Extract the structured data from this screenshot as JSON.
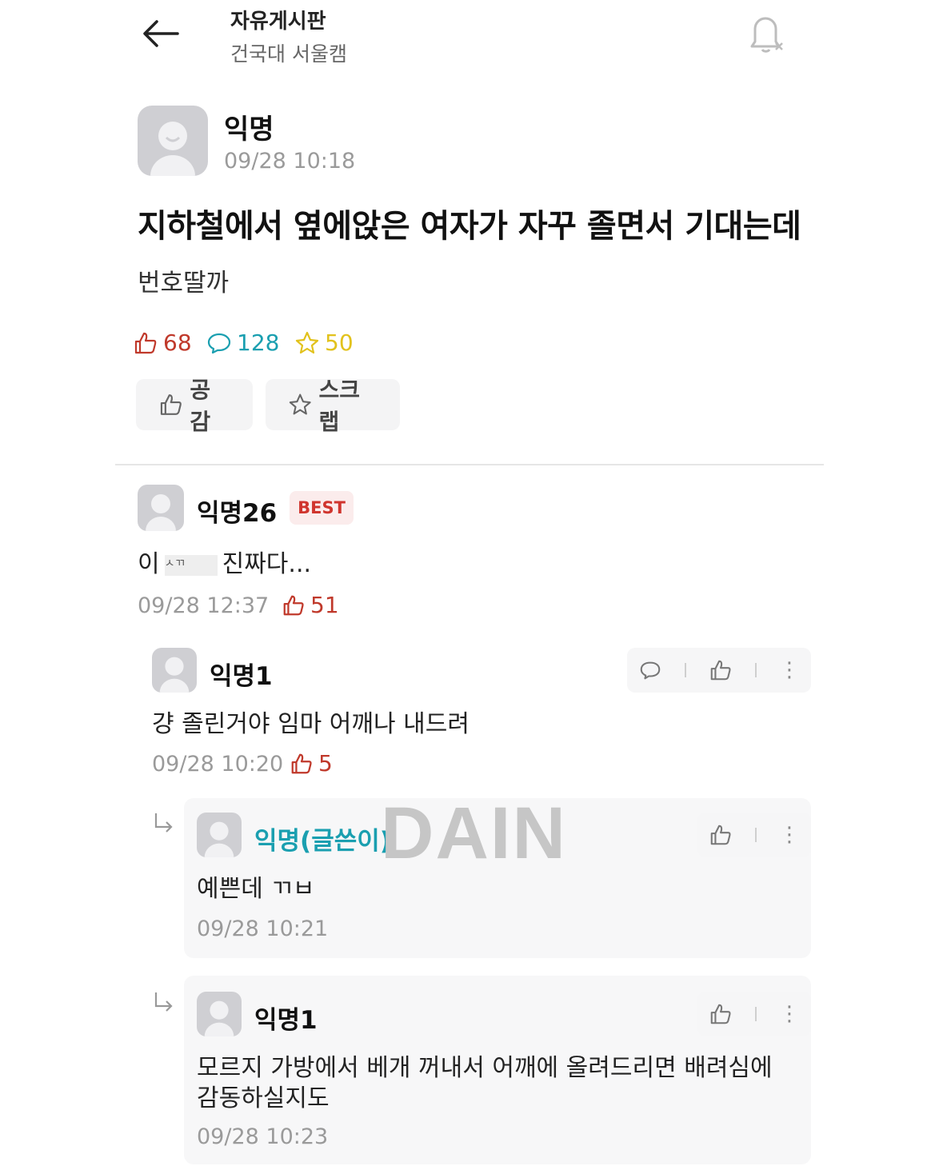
{
  "header": {
    "back_icon": "arrow-left-icon",
    "board_title": "자유게시판",
    "board_subtitle": "건국대 서울캠",
    "bell_icon": "bell-off-icon"
  },
  "post": {
    "author": "익명",
    "timestamp": "09/28 10:18",
    "title": "지하철에서 옆에앉은 여자가 자꾸 졸면서 기대는데",
    "body": "번호딸까",
    "stats": {
      "likes": "68",
      "comments": "128",
      "scraps": "50"
    },
    "actions": {
      "empathy_label": "공감",
      "scrap_label": "스크랩"
    }
  },
  "comments": [
    {
      "author": "익명26",
      "badge": "BEST",
      "text_prefix": "이",
      "text_censored": "ㅅㄲ",
      "text_suffix": "진짜다...",
      "timestamp": "09/28 12:37",
      "likes": "51"
    },
    {
      "author": "익명1",
      "text": "걍 졸린거야 임마 어깨나 내드려",
      "timestamp": "09/28 10:20",
      "likes": "5"
    }
  ],
  "replies": [
    {
      "author": "익명(글쓴이)",
      "text": "예쁜데 ㄲㅂ",
      "timestamp": "09/28 10:21"
    },
    {
      "author": "익명1",
      "text_line1": "모르지 가방에서 베개 꺼내서 어깨에 올려드리면 배려심에",
      "text_line2": "감동하실지도",
      "timestamp": "09/28 10:23"
    }
  ],
  "watermark": "DAIN",
  "colors": {
    "like": "#c0392b",
    "comment": "#1a9fb0",
    "scrap": "#e2c21c",
    "writer": "#1a9fb0",
    "best": "#d0352e"
  }
}
